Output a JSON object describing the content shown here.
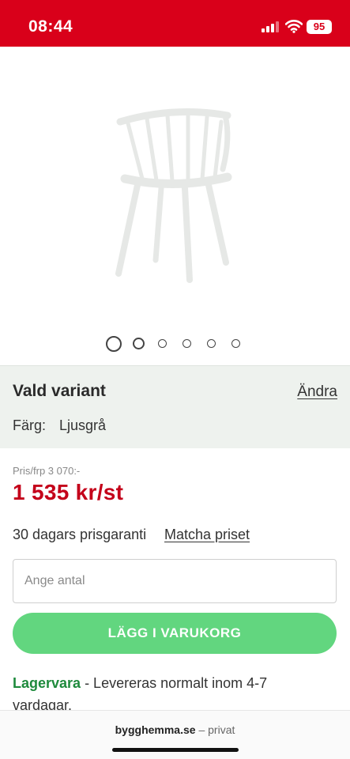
{
  "status_bar": {
    "time": "08:44",
    "battery": "95",
    "background_color": "#d9001a",
    "icons": [
      "signal-icon",
      "wifi-icon",
      "battery-icon"
    ]
  },
  "gallery": {
    "image": "white-spindle-back-chair",
    "dots_count": 6,
    "active_index": 0
  },
  "variant": {
    "title": "Vald variant",
    "change_link": "Ändra",
    "color_label": "Färg:",
    "color_value": "Ljusgrå"
  },
  "price": {
    "original": "Pris/frp 3 070:-",
    "current": "1 535 kr/st",
    "color": "#c4001a"
  },
  "guarantee": {
    "text": "30 dagars prisgaranti",
    "link": "Matcha priset"
  },
  "quantity": {
    "placeholder": "Ange antal",
    "value": ""
  },
  "cart_button": {
    "label": "LÄGG I VARUKORG",
    "color": "#62d67f"
  },
  "stock": {
    "label": "Lagervara",
    "text": " - Levereras normalt inom 4-7 vardagar.",
    "color": "#1e8a3c"
  },
  "browser": {
    "domain": "bygghemma.se",
    "separator": " – ",
    "mode": "privat"
  }
}
